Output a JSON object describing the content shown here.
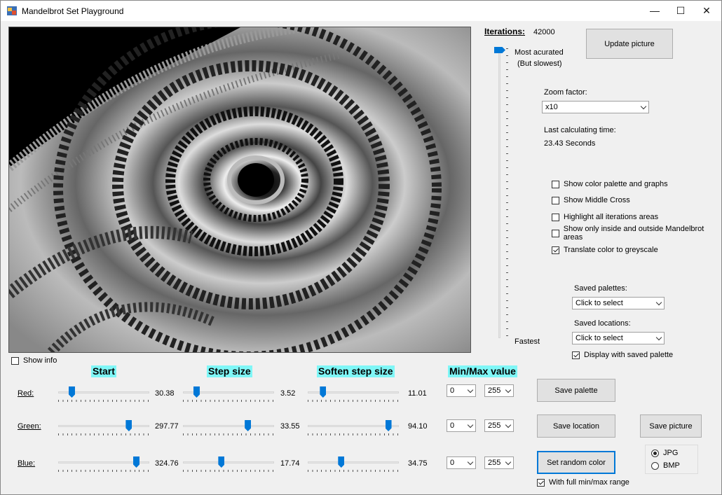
{
  "window": {
    "title": "Mandelbrot Set Playground",
    "minimize": "—",
    "maximize": "☐",
    "close": "✕"
  },
  "iterations": {
    "label": "Iterations:",
    "value": "42000",
    "most_label": "Most acurated",
    "most_sub": "(But slowest)",
    "fastest_label": "Fastest",
    "level_fraction": 1.0
  },
  "update_button": "Update picture",
  "zoom": {
    "label": "Zoom factor:",
    "value": "x10"
  },
  "calc_time": {
    "label": "Last calculating time:",
    "value": "23.43 Seconds"
  },
  "options": [
    {
      "label": "Show color palette and graphs",
      "checked": false
    },
    {
      "label": "Show Middle Cross",
      "checked": false
    },
    {
      "label": "Highlight all iterations areas",
      "checked": false
    },
    {
      "label": "Show only inside and outside Mandelbrot areas",
      "checked": false
    },
    {
      "label": "Translate color to greyscale",
      "checked": true
    }
  ],
  "saved_palettes": {
    "label": "Saved palettes:",
    "value": "Click to select"
  },
  "saved_locations": {
    "label": "Saved locations:",
    "value": "Click to select"
  },
  "display_saved_palette": {
    "label": "Display with saved palette",
    "checked": true
  },
  "show_info": {
    "label": "Show info",
    "checked": false
  },
  "headers": {
    "start": "Start",
    "step": "Step size",
    "soften": "Soften step size",
    "minmax": "Min/Max value"
  },
  "rows": [
    {
      "label": "Red:",
      "start": "30.38",
      "step": "3.52",
      "soften": "11.01",
      "min": "0",
      "max": "255",
      "start_frac": 0.11,
      "step_frac": 0.11,
      "soften_frac": 0.13
    },
    {
      "label": "Green:",
      "start": "297.77",
      "step": "33.55",
      "soften": "94.10",
      "min": "0",
      "max": "255",
      "start_frac": 0.8,
      "step_frac": 0.73,
      "soften_frac": 0.92
    },
    {
      "label": "Blue:",
      "start": "324.76",
      "step": "17.74",
      "soften": "34.75",
      "min": "0",
      "max": "255",
      "start_frac": 0.89,
      "step_frac": 0.41,
      "soften_frac": 0.35
    }
  ],
  "buttons": {
    "save_palette": "Save  palette",
    "save_location": "Save location",
    "save_picture": "Save picture",
    "random_color": "Set random color"
  },
  "full_range": {
    "label": "With full min/max range",
    "checked": true
  },
  "format": {
    "jpg": "JPG",
    "bmp": "BMP",
    "selected": "JPG"
  }
}
